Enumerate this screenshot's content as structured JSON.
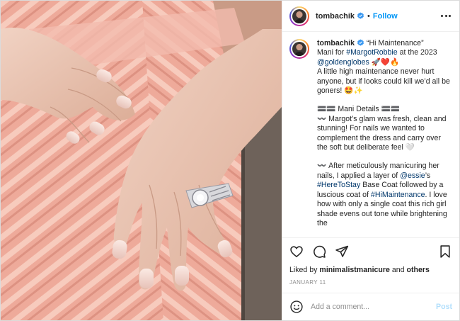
{
  "post": {
    "username": "tombachik",
    "follow_label": "Follow",
    "separator": "•"
  },
  "caption": {
    "username": "tombachik",
    "intro": "“Hi Maintenance”",
    "line1_prefix": "Mani for ",
    "tag_margot": "#MargotRobbie",
    "line1_suffix": " at the 2023",
    "mention_globes": "@goldenglobes",
    "emojis_1": " 🚀❤️🔥",
    "para1": "A little high maintenance never hurt anyone, but if looks could kill we’d all be goners! 🤩✨",
    "details_heading": "🟰🟰 Mani Details 🟰🟰",
    "para2": "〰️ Margot’s glam was fresh, clean and stunning! For nails we wanted to complement the dress and carry over the soft but deliberate feel 🤍",
    "para3_a": "〰️ After meticulously manicuring her nails, I applied a layer of ",
    "mention_essie": "@essie",
    "para3_b": "’s ",
    "tag_heretostay": "#HereToStay",
    "para3_c": " Base Coat followed by a luscious coat of ",
    "tag_himaintenance": "#HiMaintenance",
    "para3_d": ". I love how with only a single coat this rich girl shade evens out tone while brightening the"
  },
  "likes": {
    "prefix": "Liked by ",
    "user": "minimalistmanicure",
    "middle": " and ",
    "others": "others"
  },
  "date": "JANUARY 11",
  "comment": {
    "placeholder": "Add a comment...",
    "post_label": "Post"
  },
  "icons": {
    "more": "more-options-icon",
    "verified": "verified-badge-icon",
    "like": "heart-icon",
    "comment": "comment-icon",
    "share": "paper-plane-icon",
    "save": "bookmark-icon",
    "emoji": "smiley-icon"
  },
  "colors": {
    "accent": "#0095f6",
    "link": "#00376b",
    "muted": "#8e8e8e",
    "post_disabled": "#b2dffc"
  }
}
